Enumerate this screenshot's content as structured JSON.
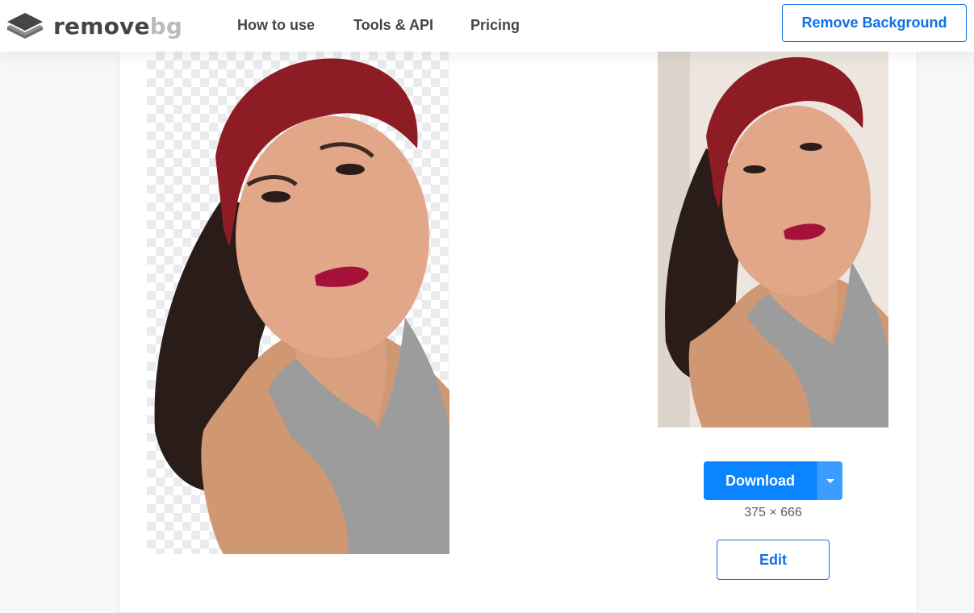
{
  "header": {
    "logo_main": "remove",
    "logo_suffix": "bg",
    "nav": [
      {
        "label": "How to use"
      },
      {
        "label": "Tools & API"
      },
      {
        "label": "Pricing"
      }
    ],
    "cta_label": "Remove Background"
  },
  "result": {
    "download_label": "Download",
    "dimensions": "375 × 666",
    "edit_label": "Edit"
  },
  "colors": {
    "accent": "#0f70e6",
    "download_bg": "#0a84ff",
    "text_dark": "#454545",
    "logo_bg_text": "#b8bcc1"
  },
  "icons": {
    "logo": "layers-icon",
    "download_dropdown": "caret-down-icon"
  }
}
